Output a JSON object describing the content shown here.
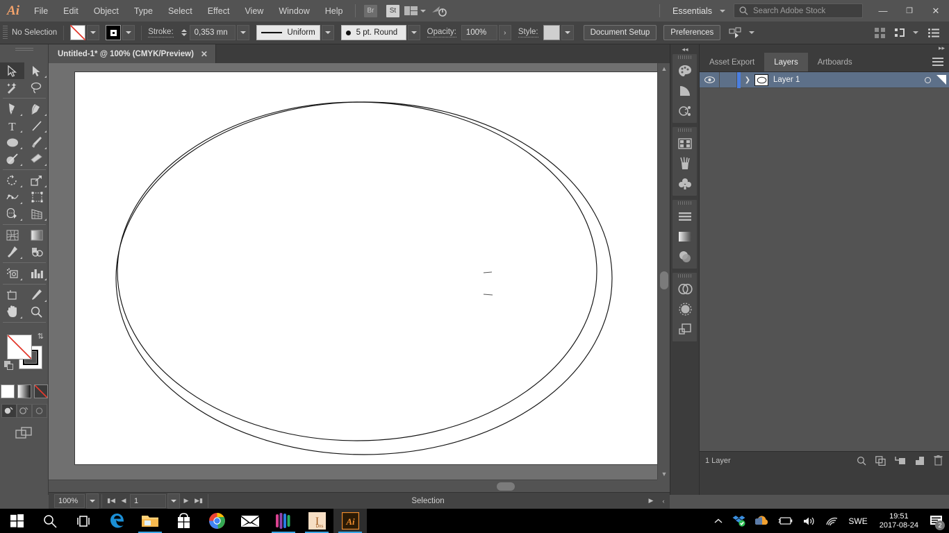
{
  "app": {
    "logo": "Ai",
    "title": "Untitled-1* @ 100% (CMYK/Preview)"
  },
  "menubar": {
    "items": [
      "File",
      "Edit",
      "Object",
      "Type",
      "Select",
      "Effect",
      "View",
      "Window",
      "Help"
    ],
    "bridge_badge": "Br",
    "stock_badge": "St",
    "workspace": "Essentials",
    "search_placeholder": "Search Adobe Stock",
    "minimize": "—",
    "restore": "❐",
    "close": "✕"
  },
  "controlbar": {
    "selection_status": "No Selection",
    "fill_label": "fill-swatch",
    "stroke_color_label": "stroke-swatch",
    "stroke_label": "Stroke:",
    "stroke_weight": "0,353 mn",
    "profile": "Uniform",
    "brush": "5 pt. Round",
    "opacity_label": "Opacity:",
    "opacity_value": "100%",
    "style_label": "Style:",
    "document_setup": "Document Setup",
    "preferences": "Preferences"
  },
  "toolbar": {
    "tools": [
      {
        "name": "selection-tool",
        "glyph": "selection",
        "selected": true,
        "corner": false
      },
      {
        "name": "direct-selection-tool",
        "glyph": "direct-selection",
        "selected": false,
        "corner": true
      },
      {
        "name": "magic-wand-tool",
        "glyph": "magic-wand",
        "selected": false,
        "corner": false
      },
      {
        "name": "lasso-tool",
        "glyph": "lasso",
        "selected": false,
        "corner": false
      },
      {
        "name": "pen-tool",
        "glyph": "pen",
        "selected": false,
        "corner": true
      },
      {
        "name": "curvature-tool",
        "glyph": "curvature",
        "selected": false,
        "corner": true
      },
      {
        "name": "type-tool",
        "glyph": "type",
        "selected": false,
        "corner": true
      },
      {
        "name": "line-segment-tool",
        "glyph": "line",
        "selected": false,
        "corner": true
      },
      {
        "name": "ellipse-tool",
        "glyph": "ellipse",
        "selected": false,
        "corner": true
      },
      {
        "name": "paintbrush-tool",
        "glyph": "paintbrush",
        "selected": false,
        "corner": true
      },
      {
        "name": "shaper-tool",
        "glyph": "shaper",
        "selected": false,
        "corner": true
      },
      {
        "name": "eraser-tool",
        "glyph": "eraser",
        "selected": false,
        "corner": true
      },
      {
        "name": "rotate-tool",
        "glyph": "rotate",
        "selected": false,
        "corner": true
      },
      {
        "name": "scale-tool",
        "glyph": "scale",
        "selected": false,
        "corner": true
      },
      {
        "name": "width-tool",
        "glyph": "width",
        "selected": false,
        "corner": true
      },
      {
        "name": "free-transform-tool",
        "glyph": "free-transform",
        "selected": false,
        "corner": false
      },
      {
        "name": "shape-builder-tool",
        "glyph": "shape-builder",
        "selected": false,
        "corner": true
      },
      {
        "name": "perspective-grid-tool",
        "glyph": "perspective-grid",
        "selected": false,
        "corner": true
      },
      {
        "name": "mesh-tool",
        "glyph": "mesh",
        "selected": false,
        "corner": false
      },
      {
        "name": "gradient-tool",
        "glyph": "gradient",
        "selected": false,
        "corner": false
      },
      {
        "name": "eyedropper-tool",
        "glyph": "eyedropper",
        "selected": false,
        "corner": true
      },
      {
        "name": "blend-tool",
        "glyph": "blend",
        "selected": false,
        "corner": false
      },
      {
        "name": "symbol-sprayer-tool",
        "glyph": "symbol-sprayer",
        "selected": false,
        "corner": true
      },
      {
        "name": "column-graph-tool",
        "glyph": "column-graph",
        "selected": false,
        "corner": true
      },
      {
        "name": "artboard-tool",
        "glyph": "artboard",
        "selected": false,
        "corner": false
      },
      {
        "name": "slice-tool",
        "glyph": "slice",
        "selected": false,
        "corner": true
      },
      {
        "name": "hand-tool",
        "glyph": "hand",
        "selected": false,
        "corner": true
      },
      {
        "name": "zoom-tool",
        "glyph": "zoom",
        "selected": false,
        "corner": false
      }
    ],
    "fill_state": "none",
    "stroke_state": "black",
    "paint_modes": [
      "color",
      "gradient",
      "none"
    ],
    "draw_modes": [
      "draw-normal",
      "draw-behind",
      "draw-inside"
    ],
    "screen_mode": "change-screen-mode"
  },
  "canvas": {
    "artwork_name": "nested-ellipse-ring",
    "artboard_color": "#ffffff",
    "pasteboard_color": "#707070",
    "stroke_color": "#000000"
  },
  "statusbar": {
    "zoom": "100%",
    "page": "1",
    "status_text": "Selection",
    "first_label": "first-page",
    "prev_label": "previous-page",
    "next_label": "next-page",
    "last_label": "last-page"
  },
  "icondock": {
    "groups": [
      [
        "color-panel-icon",
        "color-guide-icon",
        "color-themes-icon"
      ],
      [
        "swatches-panel-icon",
        "brushes-panel-icon",
        "symbols-panel-icon"
      ],
      [
        "align-panel-icon",
        "gradient-panel-icon",
        "transparency-panel-icon"
      ],
      [
        "creative-cloud-libraries-icon",
        "image-trace-icon",
        "artboards-panel-icon"
      ]
    ]
  },
  "panels": {
    "tabs": [
      {
        "label": "Asset Export",
        "active": false
      },
      {
        "label": "Layers",
        "active": true
      },
      {
        "label": "Artboards",
        "active": false
      }
    ],
    "layers": [
      {
        "name": "Layer 1",
        "visible": true,
        "locked": false,
        "selected": true,
        "color": "#4a7ee0"
      }
    ],
    "footer_count": "1 Layer",
    "footer_icons": [
      "locate-object-icon",
      "make-clipping-mask-icon",
      "create-new-sublayer-icon",
      "create-new-layer-icon",
      "delete-selection-icon"
    ]
  },
  "taskbar": {
    "items": [
      {
        "name": "start-button",
        "glyph": "windows"
      },
      {
        "name": "search-button",
        "glyph": "search"
      },
      {
        "name": "task-view-button",
        "glyph": "taskview"
      },
      {
        "name": "edge-button",
        "glyph": "edge",
        "running": false
      },
      {
        "name": "file-explorer-button",
        "glyph": "explorer",
        "running": true
      },
      {
        "name": "microsoft-store-button",
        "glyph": "store",
        "running": false
      },
      {
        "name": "chrome-button",
        "glyph": "chrome",
        "running": true
      },
      {
        "name": "mail-button",
        "glyph": "mail",
        "running": false
      },
      {
        "name": "spotify-button",
        "glyph": "spotify",
        "running": true
      },
      {
        "name": "indesign-button",
        "glyph": "indesign",
        "running": true
      },
      {
        "name": "illustrator-button",
        "glyph": "illustrator",
        "running": true,
        "active": true
      }
    ],
    "tray": [
      "show-hidden-icons",
      "dropbox-icon",
      "onedrive-icon",
      "battery-icon",
      "volume-icon",
      "wifi-icon"
    ],
    "language": "SWE",
    "time": "19:51",
    "date": "2017-08-24",
    "notification_count": "2"
  }
}
